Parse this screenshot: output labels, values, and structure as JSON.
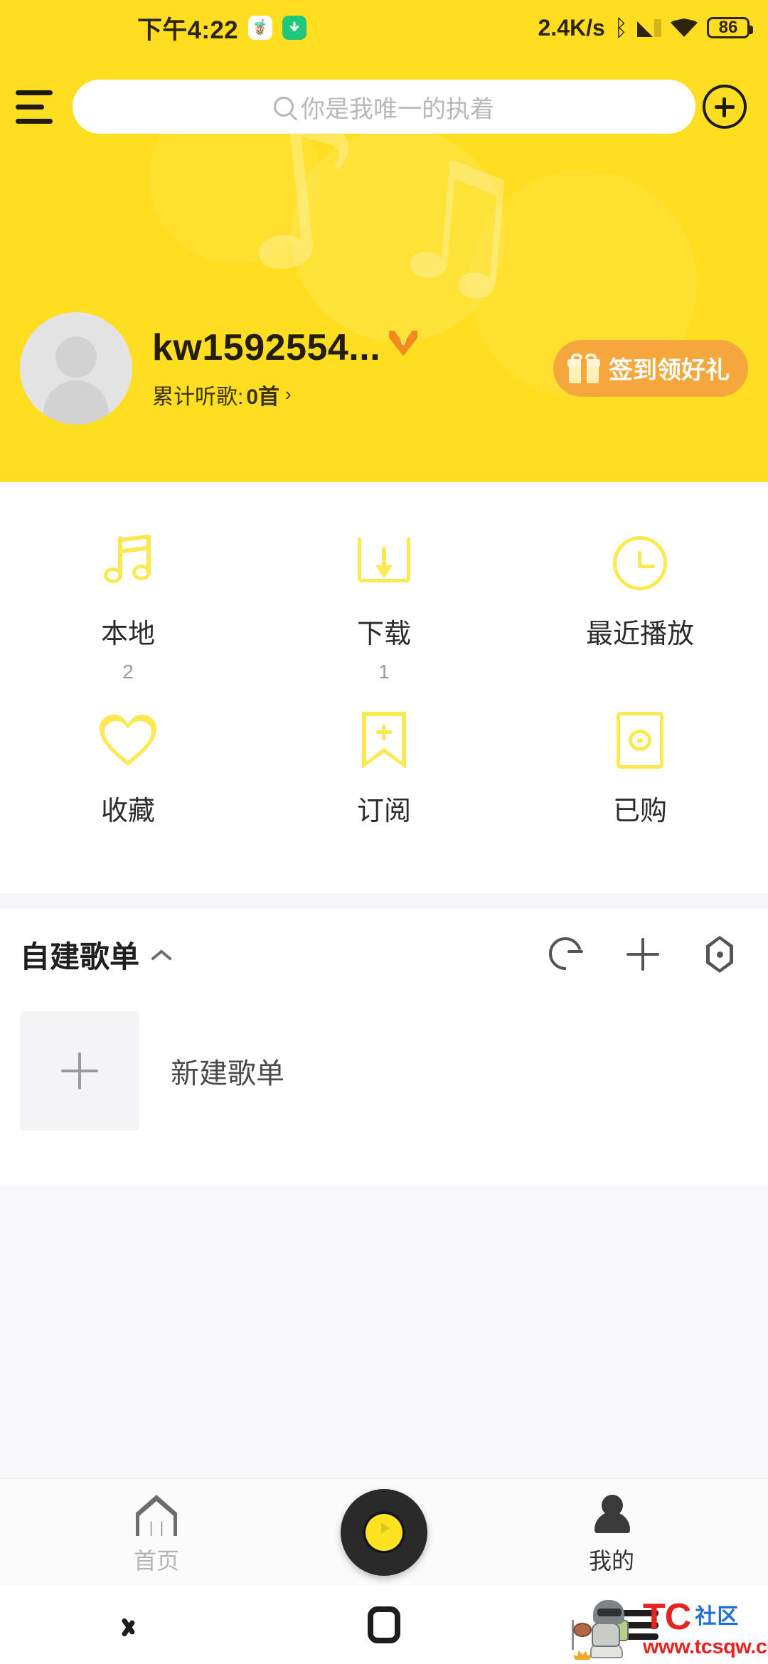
{
  "theme": {
    "brand_yellow": "#FFDE21",
    "icon_yellow": "#FCE94F",
    "accent_orange": "#F5A63C",
    "vip_orange": "#F28B1E"
  },
  "statusbar": {
    "time": "下午4:22",
    "app_icon": "drink-app-icon",
    "download_icon": "download-indicator-icon",
    "net_speed": "2.4K/s",
    "bluetooth_icon": "bluetooth-icon",
    "signal_icon": "cellular-signal-icon",
    "wifi_icon": "wifi-icon",
    "battery_level": "86"
  },
  "header": {
    "menu_icon": "hamburger-menu-icon",
    "search": {
      "icon": "search-icon",
      "placeholder": "你是我唯一的执着",
      "value": ""
    },
    "add_icon": "plus-circle-icon"
  },
  "profile": {
    "avatar_icon": "default-avatar-icon",
    "username": "kw1592554...",
    "vip_badge_label": "V",
    "listen_label": "累计听歌: ",
    "listen_count": "0首",
    "listen_arrow": "›",
    "signin_icon": "gift-icon",
    "signin_label": "签到领好礼"
  },
  "quick_grid": {
    "rows": [
      [
        {
          "icon": "music-note-icon",
          "label": "本地",
          "count": "2"
        },
        {
          "icon": "download-tray-icon",
          "label": "下载",
          "count": "1"
        },
        {
          "icon": "clock-icon",
          "label": "最近播放",
          "count": ""
        }
      ],
      [
        {
          "icon": "heart-icon",
          "label": "收藏",
          "count": ""
        },
        {
          "icon": "bookmark-plus-icon",
          "label": "订阅",
          "count": ""
        },
        {
          "icon": "purchased-disc-icon",
          "label": "已购",
          "count": ""
        }
      ]
    ]
  },
  "playlists": {
    "section_title": "自建歌单",
    "collapse_icon": "chevron-up-icon",
    "actions": [
      {
        "icon": "sync-icon",
        "name": "sync-playlists-button"
      },
      {
        "icon": "plus-icon",
        "name": "create-playlist-button"
      },
      {
        "icon": "hexagon-settings-icon",
        "name": "playlist-settings-button"
      }
    ],
    "items": [
      {
        "icon": "plus-thumbnail-icon",
        "name": "新建歌单"
      }
    ]
  },
  "tabbar": {
    "tabs": [
      {
        "icon": "home-icon",
        "label": "首页",
        "active": false
      },
      {
        "icon": "vinyl-record-icon",
        "label": "",
        "active": false
      },
      {
        "icon": "person-icon",
        "label": "我的",
        "active": true
      }
    ]
  },
  "navbar": {
    "back_icon": "nav-back-icon",
    "home_icon": "nav-home-icon",
    "recents_icon": "nav-recents-icon"
  },
  "watermark": {
    "art_icon": "pubg-character-icon",
    "brand": "TC",
    "brand_suffix": "社区",
    "url": "www.tcsqw.com"
  }
}
